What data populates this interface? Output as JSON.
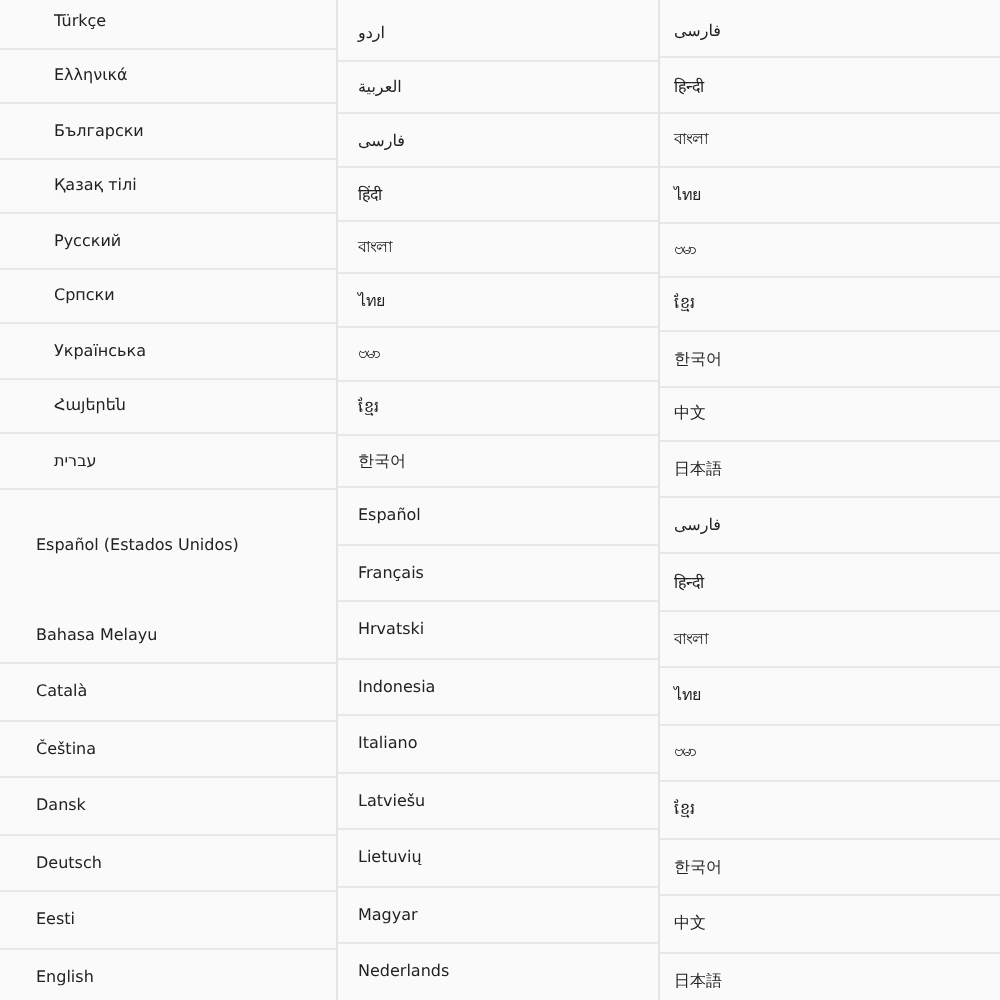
{
  "panels": [
    {
      "sections": [
        {
          "items": [
            "Türkçe",
            "Ελληνικά",
            "Български",
            "Қазақ тілі",
            "Русский",
            "Српски",
            "Українська",
            "Հայերեն",
            "עברית"
          ]
        },
        {
          "items": [
            "Español (Estados Unidos)",
            "Bahasa Melayu",
            "Català",
            "Čeština",
            "Dansk",
            "Deutsch",
            "Eesti",
            "English"
          ]
        }
      ]
    },
    {
      "sections": [
        {
          "items": [
            "اردو",
            "العربية",
            "فارسی",
            "हिंदी",
            "বাংলা",
            "ไทย",
            "ဗမာ",
            "ខ្មែរ",
            "한국어"
          ]
        },
        {
          "items": [
            "Español",
            "Français",
            "Hrvatski",
            "Indonesia",
            "Italiano",
            "Latviešu",
            "Lietuvių",
            "Magyar",
            "Nederlands"
          ]
        }
      ]
    },
    {
      "sections": [
        {
          "items": [
            "فارسی",
            "हिन्दी",
            "বাংলা",
            "ไทย",
            "ဗမာ",
            "ខ្មែរ",
            "한국어",
            "中文",
            "日本語"
          ]
        },
        {
          "items": [
            "فارسی",
            "हिन्दी",
            "বাংলা",
            "ไทย",
            "ဗမာ",
            "ខ្មែរ",
            "한국어",
            "中文",
            "日本語"
          ]
        }
      ]
    }
  ]
}
